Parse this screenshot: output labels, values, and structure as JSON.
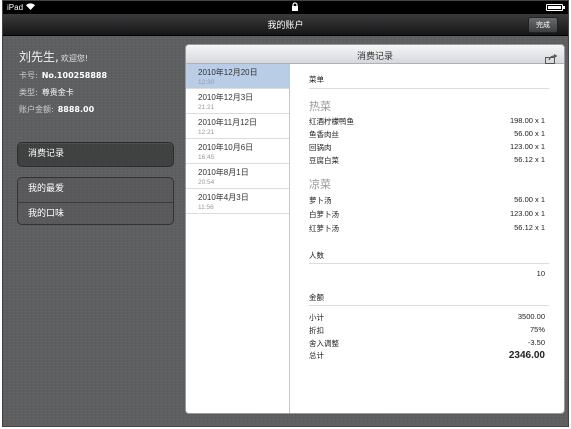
{
  "status": {
    "carrier": "iPad"
  },
  "nav": {
    "title": "我的账户",
    "done": "完成"
  },
  "user": {
    "name": "刘先生,",
    "greeting": "欢迎您!",
    "card_label": "卡号:",
    "card_value": "No.100258888",
    "type_label": "类型:",
    "type_value": "尊贵金卡",
    "balance_label": "账户金额:",
    "balance_value": "8888.00"
  },
  "menu": {
    "records": "消费记录",
    "favorites": "我的最爱",
    "taste": "我的口味"
  },
  "panel": {
    "title": "消费记录",
    "list": [
      {
        "date": "2010年12月20日",
        "time": "12:30",
        "selected": true
      },
      {
        "date": "2010年12月3日",
        "time": "21:21"
      },
      {
        "date": "2010年11月12日",
        "time": "12:21"
      },
      {
        "date": "2010年10月6日",
        "time": "16:45"
      },
      {
        "date": "2010年8月1日",
        "time": "20:54"
      },
      {
        "date": "2010年4月3日",
        "time": "11:56"
      }
    ],
    "menu_label": "菜单",
    "hot": {
      "title": "热菜",
      "items": [
        {
          "name": "红酒柠檬鸭鱼",
          "value": "198.00 x 1"
        },
        {
          "name": "鱼香肉丝",
          "value": "56.00 x 1"
        },
        {
          "name": "回锅肉",
          "value": "123.00 x 1"
        },
        {
          "name": "豆腐白菜",
          "value": "56.12 x 1"
        }
      ]
    },
    "cold": {
      "title": "凉菜",
      "items": [
        {
          "name": "萝卜汤",
          "value": "56.00 x 1"
        },
        {
          "name": "白萝卜汤",
          "value": "123.00 x 1"
        },
        {
          "name": "红萝卜汤",
          "value": "56.12 x 1"
        }
      ]
    },
    "people_label": "人数",
    "people_value": "10",
    "amount_label": "金额",
    "amount": {
      "subtotal_label": "小计",
      "subtotal": "3500.00",
      "discount_label": "折扣",
      "discount": "75%",
      "round_label": "舍入调整",
      "round": "-3.50",
      "total_label": "总计",
      "total": "2346.00"
    }
  }
}
